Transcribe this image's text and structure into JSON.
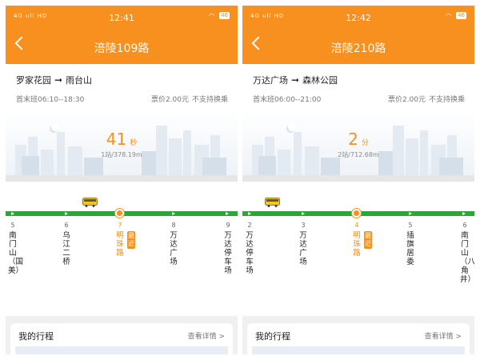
{
  "colors": {
    "accent": "#f7901e",
    "route_line": "#2aa63c",
    "status_text": "#ffffff"
  },
  "status_bar": {
    "signal_icons": "4G ull HD",
    "battery": "46"
  },
  "screens": [
    {
      "time": "12:41",
      "title": "涪陵109路",
      "from": "罗家花园",
      "to": "雨台山",
      "schedule": "首末班06:10--18:30",
      "fare": "票价2.00元",
      "transfer": "不支持换乘",
      "eta_value": "41",
      "eta_unit": "秒",
      "eta_sub": "1站/378.19m",
      "badge": "最近",
      "stations": [
        {
          "num": "5",
          "name": "南门山（国美）"
        },
        {
          "num": "6",
          "name": "乌江二桥"
        },
        {
          "num": "7",
          "name": "明珠路",
          "current": true
        },
        {
          "num": "8",
          "name": "万达广场"
        },
        {
          "num": "9",
          "name": "万达停车场"
        }
      ],
      "trip_title": "我的行程",
      "trip_link": "查看详情 >"
    },
    {
      "time": "12:42",
      "title": "涪陵210路",
      "from": "万达广场",
      "to": "森林公园",
      "schedule": "首末班06:00--21:00",
      "fare": "票价2.00元",
      "transfer": "不支持换乘",
      "eta_value": "2",
      "eta_unit": "分",
      "eta_sub": "2站/712.68m",
      "badge": "最近",
      "stations": [
        {
          "num": "2",
          "name": "万达停车场"
        },
        {
          "num": "3",
          "name": "万达广场"
        },
        {
          "num": "4",
          "name": "明珠路",
          "current": true
        },
        {
          "num": "5",
          "name": "插旗居委"
        },
        {
          "num": "6",
          "name": "南门山（八角井）"
        }
      ],
      "trip_title": "我的行程",
      "trip_link": "查看详情 >"
    }
  ]
}
